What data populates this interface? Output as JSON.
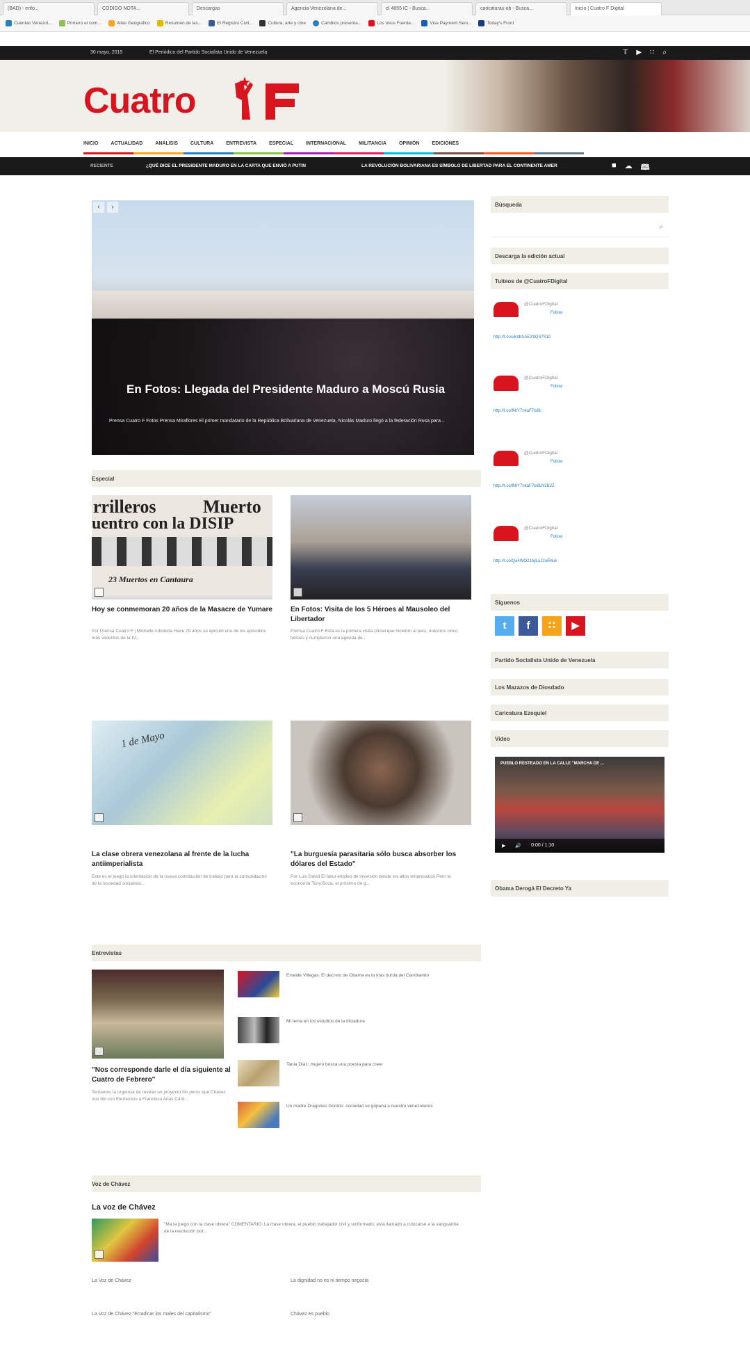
{
  "browser": {
    "tabs": [
      "(BAD) - enfo...",
      "CODIGO NOTA...",
      "Descargas",
      "Agencia Venezolana de...",
      "el 4855 IC - Busca...",
      "caricaturas-ob - Busca...",
      "Inicio | Cuatro F Digital"
    ],
    "bookmarks": [
      "Cuentas Venezol...",
      "Primero el com...",
      "Atlas Geografico",
      "Resumen de las...",
      "El Registro Civil...",
      "Cultura, arte y cine",
      "Cambios presenta...",
      "Los Veus Fuente...",
      "Visa Payment Serv...",
      "Today's Front"
    ]
  },
  "topbar": {
    "date": "30 mayo, 2015",
    "slogan": "El Periódico del Partido Socialista Unido de Venezuela",
    "icons": [
      "twitter-icon",
      "youtube-icon",
      "rss-icon",
      "search-icon"
    ]
  },
  "logo": {
    "text": "Cuatro",
    "suffix": "F"
  },
  "nav": {
    "items": [
      "INICIO",
      "ACTUALIDAD",
      "ANÁLISIS",
      "CULTURA",
      "ENTREVISTA",
      "ESPECIAL",
      "INTERNACIONAL",
      "MILITANCIA",
      "OPINIÓN",
      "EDICIONES"
    ],
    "colors": [
      "#d8151f",
      "#f5a623",
      "#2a7fbd",
      "#8bc34a",
      "#9c27b0",
      "#e91e63",
      "#00bcd4",
      "#795548",
      "#ff5722",
      "#607d8b"
    ]
  },
  "ticker": {
    "label": "RECIENTE",
    "item1": "¿QUÉ DICE EL PRESIDENTE MADURO EN LA CARTA QUE ENVIÓ A PUTIN",
    "item2": "LA REVOLUCIÓN BOLIVARIANA ES SÍMBOLO DE LIBERTAD PARA EL CONTINENTE AMER"
  },
  "slider": {
    "caption": "En Fotos: Llegada del Presidente Maduro a Moscú Rusia",
    "excerpt": "Prensa Cuatro F Fotos Prensa Miraflores El primer mandatario de la República Bolivariana de Venezuela, Nicolás Maduro llegó a la federación Rusa para..."
  },
  "sidebar": {
    "search_label": "Búsqueda",
    "download_label": "Descarga la edición actual",
    "tweets_label": "Tuiteos de @CuatroFDigital",
    "tweets": [
      {
        "handle": "@CuatroFDigital",
        "follow": "Follow",
        "text": "",
        "link": "http://t.co/uKdbSAEX9QS7S10"
      },
      {
        "handle": "@CuatroFDigital",
        "follow": "Follow",
        "text": "",
        "link": "http://t.co/fNtY7nkaF7ls8L"
      },
      {
        "handle": "@CuatroFDigital",
        "follow": "Follow",
        "text": "",
        "link": "http://t.co/fNtY7nkaF7ls8LN2B2Z"
      },
      {
        "handle": "@CuatroFDigital",
        "follow": "Follow",
        "text": "",
        "link": "http://t.co/Qa4WO21bjlLuJ2wRliuk"
      }
    ],
    "follow_label": "Síguenos",
    "links": [
      "Partido Socialista Unido de Venezuela",
      "Los Mazazos de Diosdado",
      "Caricatura Ezequiel"
    ],
    "video_label": "Video",
    "video_title": "PUEBLO RESTEADO EN LA CALLE \"MARCHA DE ...",
    "video_time": "0:00 / 1:10",
    "last_link": "Obama Derogá El Decreto Ya"
  },
  "especial": {
    "label": "Especial",
    "cards": [
      {
        "title": "Hoy se conmemoran 20 años de la Masacre de Yumare",
        "excerpt": "Por Prensa Cuatro F | Michelle Arboleda Hace 29 años se ejecutó uno de los episodios más violentos de la IV..."
      },
      {
        "title": "En Fotos: Visita de los 5 Héroes al Mausoleo del Libertador",
        "excerpt": "Prensa Cuatro F Esta es la primera visita oficial que hicieron al país, nuestros cinco héroes y cumplieron una agenda de..."
      },
      {
        "title": "La clase obrera venezolana al frente de la lucha antiimperialista",
        "excerpt": "Este es el juego la orientación de la nueva constitución de trabajo para la consolidación de la sociedad socialista..."
      },
      {
        "title": "\"La burguesía parasitaria sólo busca absorber los dólares del Estado\"",
        "excerpt": "Por Luis David El falso empleo de inversión desde los altos empresarios Pero la economía Tony Boza, el próximo de g..."
      }
    ],
    "card1_headline_top": "rrilleros",
    "card1_headline_top2": "Muerto",
    "card1_headline_mid": "uentro con la DISIP",
    "card1_headline_bot": "23 Muertos en Cantaura",
    "card3_overlay": "1 de Mayo"
  },
  "entrevistas": {
    "label": "Entrevistas",
    "main": {
      "title": "\"Nos corresponde darle el día siguiente al Cuatro de Febrero\"",
      "excerpt": "Teníamos la urgencia de revelar un proyecto bis peros que Chávez nos dio con Elementos a Francisco Arias Cárd..."
    },
    "items": [
      "Emeide Villegas: El decreto de Obama es la mas burda del Cambiando",
      "Mi tema en los estudios de la dictadura",
      "Tania Díaz: mujero busca una poesía para creer",
      "Un madre Dragones Gordos: sociedad se gripana a nuestro venezolanos"
    ]
  },
  "voz": {
    "label": "Voz de Chávez",
    "title": "La voz de Chávez",
    "excerpt": "\"Ma la juego con la clase obrera\" COMENTARIO: La clase obrera, el pueblo trabajador civil y uniformado, está llamado a colocarse a la vanguardia de la revolución bol...",
    "links": [
      "La Voz de Chávez",
      "La dignidad no es ni tiempo negocia",
      "La Voz de Chávez \"Erradicar los males del capitalismo\"",
      "Chávez es pueblo"
    ]
  },
  "colors": {
    "brand_red": "#d8151f",
    "dark": "#1a1a1a",
    "section_bg": "#f0efe6"
  }
}
